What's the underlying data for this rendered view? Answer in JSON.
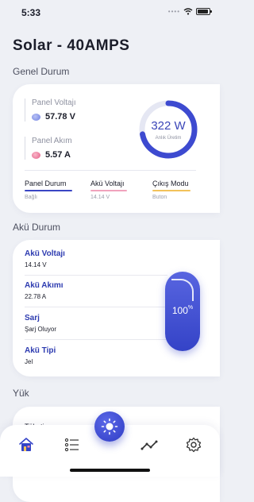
{
  "status_bar": {
    "time": "5:33"
  },
  "app": {
    "title": "Solar - 40AMPS"
  },
  "genel_durum": {
    "section_title": "Genel Durum",
    "panel_voltaji": {
      "label": "Panel Voltajı",
      "value": "57.78 V"
    },
    "panel_akim": {
      "label": "Panel Akım",
      "value": "5.57 A"
    },
    "gauge": {
      "value": "322 W",
      "label": "Anlık Üretim",
      "fraction": 0.72
    },
    "stats": [
      {
        "label": "Panel Durum",
        "value": "Bağlı",
        "color": "#3a46c4"
      },
      {
        "label": "Akü Voltajı",
        "value": "14.14 V",
        "color": "#f0a3bd"
      },
      {
        "label": "Çıkış Modu",
        "value": "Buton",
        "color": "#f2c25a"
      }
    ]
  },
  "aku_durum": {
    "section_title": "Akü Durum",
    "rows": [
      {
        "label": "Akü Voltajı",
        "value": "14.14 V"
      },
      {
        "label": "Akü Akımı",
        "value": "22.78 A"
      },
      {
        "label": "Sarj",
        "value": "Şarj Oluyor"
      },
      {
        "label": "Akü Tipi",
        "value": "Jel"
      }
    ],
    "battery_level": {
      "number": "100",
      "unit": "%"
    }
  },
  "yuk": {
    "section_title": "Yük",
    "first_row_label": "Tüketim"
  },
  "tabbar": {
    "items": [
      "home-icon",
      "list-icon",
      "sun-icon",
      "chart-icon",
      "settings-icon"
    ],
    "accent": "#3443c7"
  }
}
